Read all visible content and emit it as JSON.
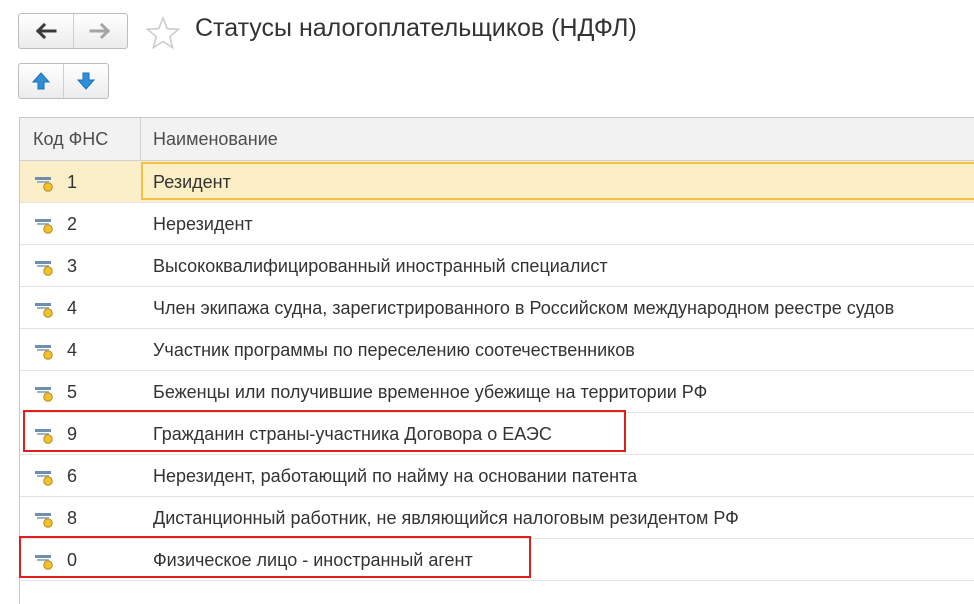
{
  "header": {
    "title": "Статусы налогоплательщиков (НДФЛ)",
    "back_icon": "arrow-left-icon",
    "forward_icon": "arrow-right-icon",
    "favorite_icon": "star-outline-icon"
  },
  "toolbar": {
    "move_up_icon": "arrow-up-icon",
    "move_down_icon": "arrow-down-icon"
  },
  "table": {
    "columns": [
      "Код ФНС",
      "Наименование"
    ],
    "row_icon": "catalog-item-icon",
    "rows": [
      {
        "code": "1",
        "name": "Резидент",
        "selected": true
      },
      {
        "code": "2",
        "name": "Нерезидент"
      },
      {
        "code": "3",
        "name": "Высококвалифицированный иностранный специалист"
      },
      {
        "code": "4",
        "name": "Член экипажа судна, зарегистрированного в Российском международном реестре судов"
      },
      {
        "code": "4",
        "name": "Участник программы по переселению соотечественников"
      },
      {
        "code": "5",
        "name": "Беженцы или получившие временное убежище на территории РФ"
      },
      {
        "code": "9",
        "name": "Гражданин страны-участника Договора о ЕАЭС",
        "highlighted": true
      },
      {
        "code": "6",
        "name": "Нерезидент, работающий по найму на основании патента"
      },
      {
        "code": "8",
        "name": "Дистанционный работник, не являющийся налоговым резидентом РФ"
      },
      {
        "code": "0",
        "name": "Физическое лицо - иностранный агент",
        "highlighted": true
      }
    ]
  },
  "colors": {
    "selection": "#fbefc9",
    "selection_border": "#f0c24a",
    "highlight_border": "#e11d1d",
    "arrow_blue": "#2f8fd8"
  }
}
